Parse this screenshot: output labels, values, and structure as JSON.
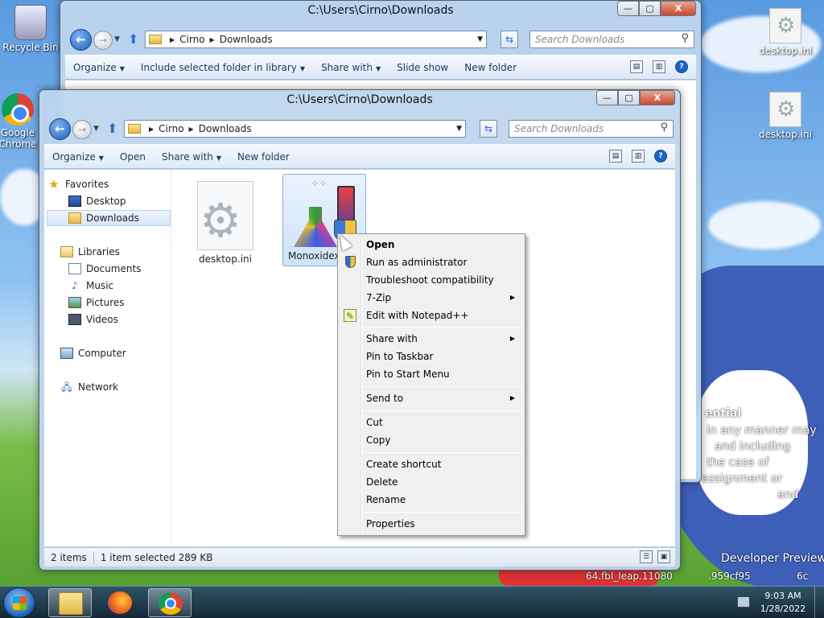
{
  "desktop": {
    "icons": [
      {
        "label": "Recycle Bin"
      },
      {
        "label": "Google Chrome"
      },
      {
        "label": "desktop.ini"
      },
      {
        "label": "desktop.ini"
      }
    ],
    "overlay_text": [
      "ential",
      "in any manner may",
      "and including",
      "the case of",
      "assignment or",
      "and",
      "Developer Preview",
      "64.fbl_leap.11080",
      ".959cf95",
      "6c"
    ]
  },
  "back_window": {
    "title": "C:\\Users\\Cirno\\Downloads",
    "address": [
      "Cirno",
      "Downloads"
    ],
    "search_placeholder": "Search Downloads",
    "toolbar": [
      "Organize",
      "Include selected folder in library",
      "Share with",
      "Slide show",
      "New folder"
    ]
  },
  "window": {
    "title": "C:\\Users\\Cirno\\Downloads",
    "controls": {
      "minimize": "—",
      "maximize": "▢",
      "close": "X"
    },
    "address": [
      "Cirno",
      "Downloads"
    ],
    "search_placeholder": "Search Downloads",
    "toolbar": {
      "organize": "Organize",
      "open": "Open",
      "share_with": "Share with",
      "new_folder": "New folder"
    },
    "nav": {
      "favorites": "Favorites",
      "desktop": "Desktop",
      "downloads": "Downloads",
      "libraries": "Libraries",
      "documents": "Documents",
      "music": "Music",
      "pictures": "Pictures",
      "videos": "Videos",
      "computer": "Computer",
      "network": "Network"
    },
    "files": [
      {
        "name": "desktop.ini"
      },
      {
        "name": "Monoxidex8"
      }
    ],
    "status": {
      "count": "2 items",
      "selection": "1 item selected  289 KB"
    }
  },
  "context_menu": {
    "open": "Open",
    "run_as_admin": "Run as administrator",
    "troubleshoot": "Troubleshoot compatibility",
    "sevenzip": "7-Zip",
    "notepadpp": "Edit with Notepad++",
    "share_with": "Share with",
    "pin_taskbar": "Pin to Taskbar",
    "pin_start": "Pin to Start Menu",
    "send_to": "Send to",
    "cut": "Cut",
    "copy": "Copy",
    "create_shortcut": "Create shortcut",
    "delete": "Delete",
    "rename": "Rename",
    "properties": "Properties"
  },
  "taskbar": {
    "time": "9:03 AM",
    "date": "1/28/2022"
  }
}
